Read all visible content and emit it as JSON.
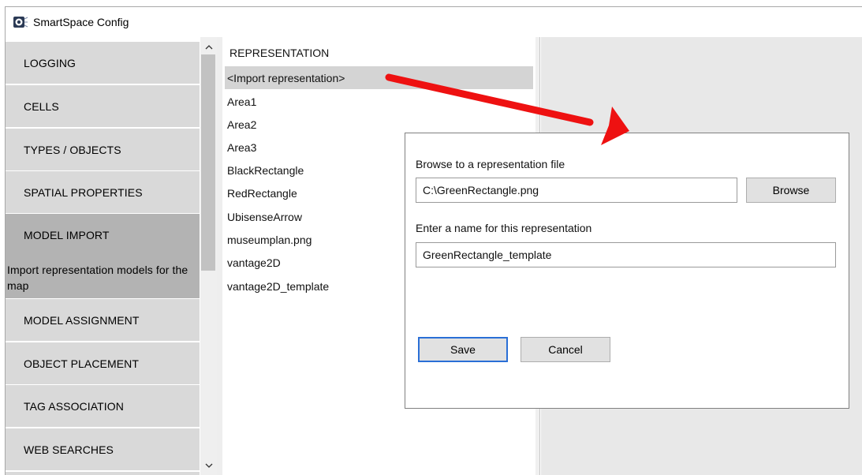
{
  "window": {
    "title": "SmartSpace Config",
    "icon": "smartspace-app-icon"
  },
  "sidebar": {
    "items": [
      {
        "label": "LOGGING"
      },
      {
        "label": "CELLS"
      },
      {
        "label": "TYPES / OBJECTS"
      },
      {
        "label": "SPATIAL PROPERTIES"
      },
      {
        "label": "MODEL IMPORT",
        "description": "Import representation models for the map",
        "active": true
      },
      {
        "label": "MODEL ASSIGNMENT"
      },
      {
        "label": "OBJECT PLACEMENT"
      },
      {
        "label": "TAG ASSOCIATION"
      },
      {
        "label": "WEB SEARCHES"
      }
    ],
    "scroll_up_icon": "chevron-up-icon",
    "scroll_down_icon": "chevron-down-icon"
  },
  "representations": {
    "header": "REPRESENTATION",
    "items": [
      "<Import representation>",
      "Area1",
      "Area2",
      "Area3",
      "BlackRectangle",
      "RedRectangle",
      "UbisenseArrow",
      "museumplan.png",
      "vantage2D",
      "vantage2D_template"
    ],
    "selected_index": 0
  },
  "dialog": {
    "file_label": "Browse to a representation file",
    "file_value": "C:\\GreenRectangle.png",
    "browse_label": "Browse",
    "name_label": "Enter a name for this representation",
    "name_value": "GreenRectangle_template",
    "save_label": "Save",
    "cancel_label": "Cancel"
  },
  "annotation": {
    "arrow_color": "#ee1111"
  }
}
